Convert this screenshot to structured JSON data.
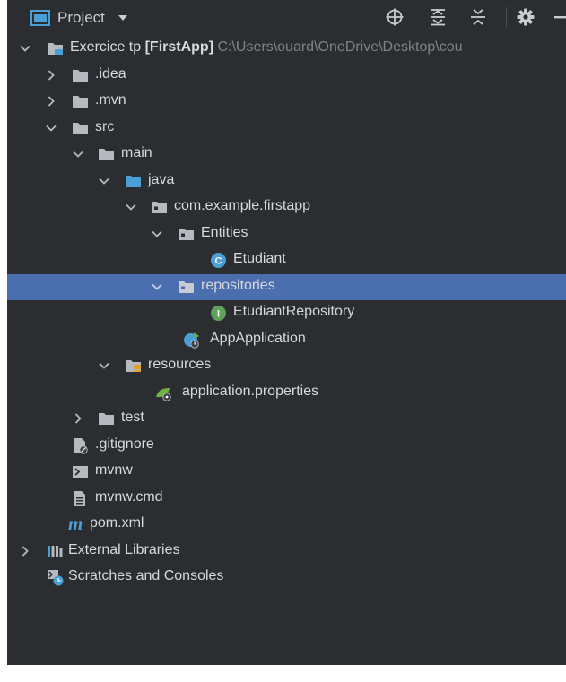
{
  "panel": {
    "title": "Project"
  },
  "colors": {
    "background": "#2b2d30",
    "selection": "#4b6eaf",
    "text": "#d7d9dc",
    "folder": "#b5bac1",
    "source_folder": "#4a9fd6"
  },
  "tree": {
    "root": {
      "name": "Exercice tp",
      "module": "[FirstApp]",
      "path": "C:\\Users\\ouard\\OneDrive\\Desktop\\cou"
    },
    "idea": ".idea",
    "mvn": ".mvn",
    "src": "src",
    "main": "main",
    "java": "java",
    "package": "com.example.firstapp",
    "entities": "Entities",
    "etudiant": "Etudiant",
    "repositories": "repositories",
    "etudiant_repository": "EtudiantRepository",
    "app_application": "AppApplication",
    "resources": "resources",
    "application_properties": "application.properties",
    "test": "test",
    "gitignore": ".gitignore",
    "mvnw": "mvnw",
    "mvnw_cmd": "mvnw.cmd",
    "pom": "pom.xml",
    "external_libraries": "External Libraries",
    "scratches": "Scratches and Consoles"
  },
  "icon_names": {
    "class": "C",
    "interface": "I",
    "maven": "m"
  }
}
